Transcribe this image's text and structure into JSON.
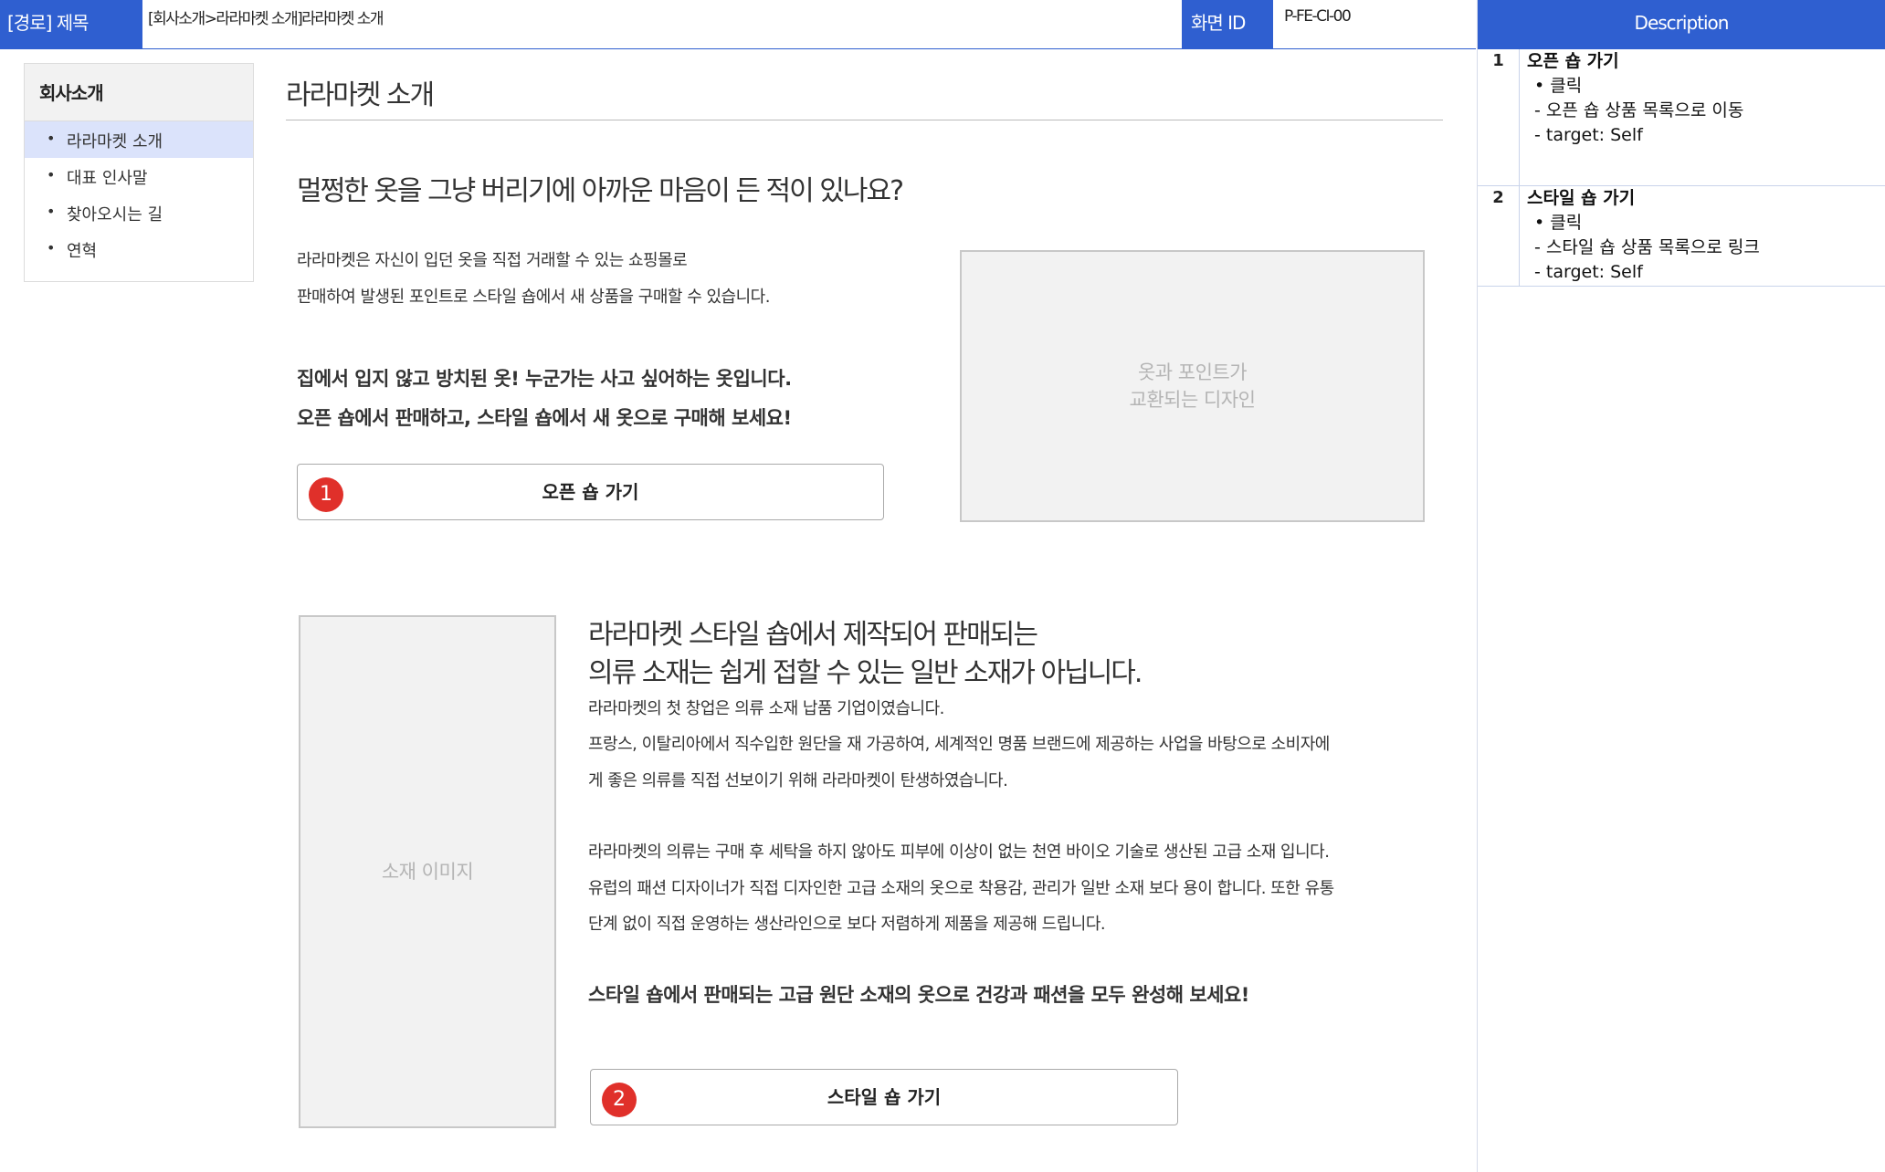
{
  "header": {
    "title": "[경로] 제목",
    "path": "[회사소개>라라마켓 소개]라라마켓 소개",
    "screen_id_label": "화면 ID",
    "screen_id_value": "P-FE-CI-00"
  },
  "description": {
    "heading": "Description",
    "items": [
      {
        "num": "1",
        "title": "오픈 숍 가기",
        "lines": [
          "•  클릭",
          "- 오픈 숍 상품 목록으로 이동",
          "- target: Self"
        ]
      },
      {
        "num": "2",
        "title": "스타일 숍 가기",
        "lines": [
          "•  클릭",
          "- 스타일 숍 상품 목록으로 링크",
          "- target: Self"
        ]
      }
    ]
  },
  "sidebar": {
    "title": "회사소개",
    "items": [
      {
        "label": "라라마켓 소개"
      },
      {
        "label": "대표 인사말"
      },
      {
        "label": "찾아오시는 길"
      },
      {
        "label": "연혁"
      }
    ]
  },
  "main": {
    "page_title": "라라마켓 소개",
    "section1": {
      "heading": "멀쩡한 옷을 그냥 버리기에 아까운 마음이 든 적이 있나요?",
      "para": [
        "라라마켓은 자신이 입던 옷을 직접 거래할 수 있는 쇼핑몰로",
        "판매하여 발생된 포인트로 스타일 숍에서 새 상품을 구매할 수 있습니다."
      ],
      "bold": [
        "집에서 입지 않고 방치된 옷!  누군가는 사고 싶어하는 옷입니다.",
        "오픈 숍에서 판매하고, 스타일 숍에서 새 옷으로 구매해 보세요!"
      ],
      "button_label": "오픈 숍 가기",
      "badge": "1",
      "image_text": [
        "옷과 포인트가",
        "교환되는 디자인"
      ]
    },
    "section2": {
      "image_text": "소재 이미지",
      "heading": [
        "라라마켓 스타일 숍에서 제작되어 판매되는",
        "의류 소재는 쉽게 접할 수 있는 일반 소재가 아닙니다."
      ],
      "para1": [
        "라라마켓의 첫 창업은 의류 소재 납품 기업이였습니다.",
        "프랑스, 이탈리아에서 직수입한 원단을 재 가공하여, 세계적인 명품 브랜드에 제공하는 사업을 바탕으로 소비자에",
        "게 좋은 의류를 직접 선보이기 위해 라라마켓이 탄생하였습니다."
      ],
      "para2": [
        "라라마켓의 의류는 구매 후 세탁을 하지 않아도 피부에 이상이 없는 천연 바이오 기술로 생산된 고급 소재 입니다.",
        "유럽의 패션 디자이너가 직접 디자인한 고급 소재의 옷으로 착용감, 관리가 일반 소재 보다 용이 합니다. 또한 유통",
        "단계 없이 직접 운영하는 생산라인으로 보다 저렴하게 제품을 제공해 드립니다."
      ],
      "bold": "스타일 숍에서 판매되는 고급 원단 소재의 옷으로 건강과 패션을 모두 완성해 보세요!",
      "button_label": "스타일 숍 가기",
      "badge": "2"
    }
  }
}
